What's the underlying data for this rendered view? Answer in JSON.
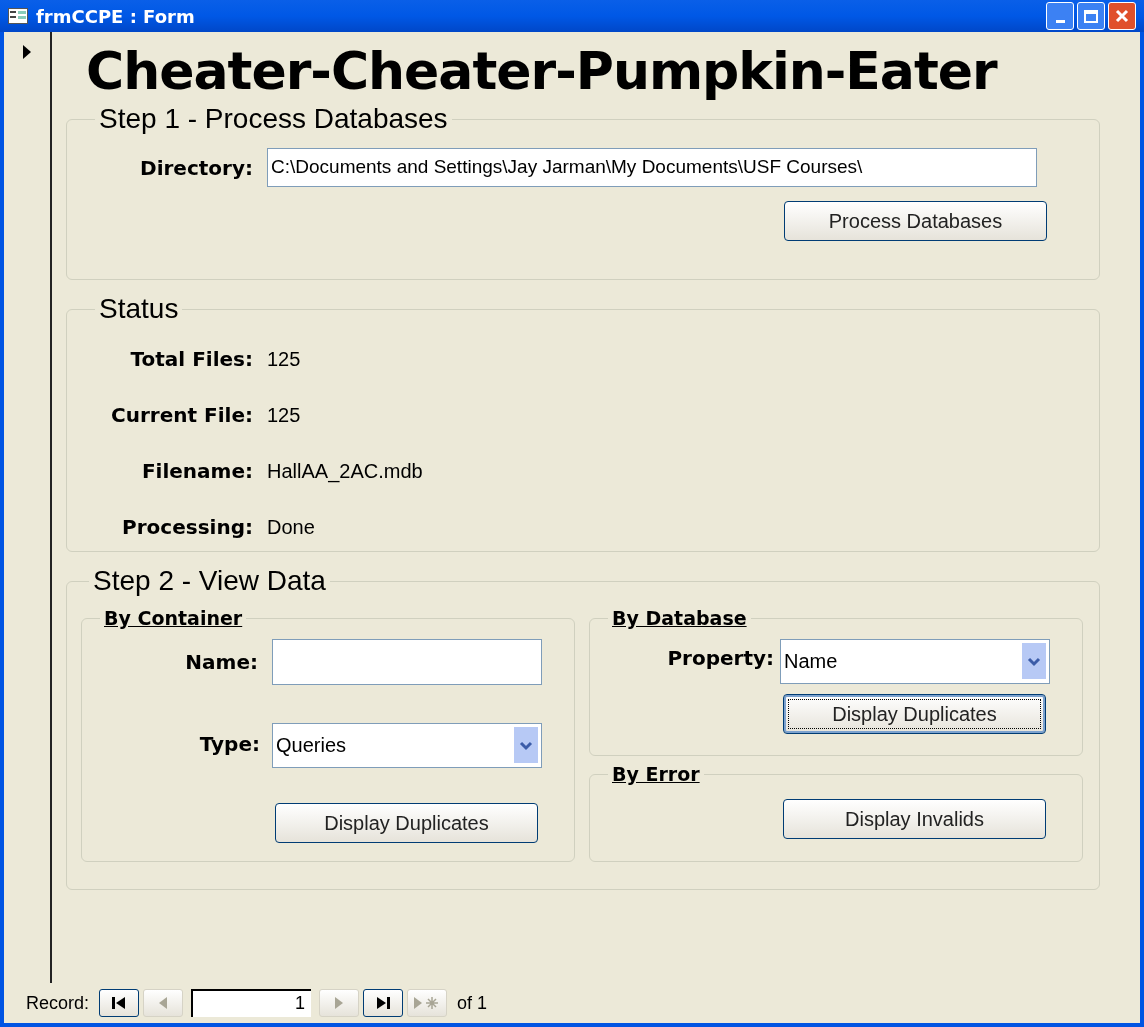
{
  "window": {
    "title": "frmCCPE : Form"
  },
  "heading": "Cheater-Cheater-Pumpkin-Eater",
  "step1": {
    "title": "Step 1 - Process Databases",
    "directory": {
      "label": "Directory:",
      "value": "C:\\Documents and Settings\\Jay Jarman\\My Documents\\USF Courses\\"
    },
    "button": {
      "label": "Process Databases",
      "focused": false
    }
  },
  "status": {
    "title": "Status",
    "rows": [
      {
        "label": "Total Files:",
        "value": "125"
      },
      {
        "label": "Current File:",
        "value": "125"
      },
      {
        "label": "Filename:",
        "value": "HallAA_2AC.mdb"
      },
      {
        "label": "Processing:",
        "value": "Done"
      }
    ]
  },
  "step2": {
    "title": "Step 2 - View Data",
    "by_container": {
      "title": "By Container",
      "name": {
        "label": "Name:"
      },
      "type": {
        "label": "Type:",
        "value": "Queries"
      },
      "button": {
        "label": "Display Duplicates",
        "focused": false
      }
    },
    "by_database": {
      "title": "By Database",
      "property": {
        "label": "Property:",
        "value": "Name"
      },
      "button": {
        "label": "Display Duplicates",
        "focused": true
      }
    },
    "by_error": {
      "title": "By Error",
      "button": {
        "label": "Display Invalids",
        "focused": false
      }
    }
  },
  "record_nav": {
    "label": "Record:",
    "before": [
      {
        "kind": "first",
        "disabled": false
      },
      {
        "kind": "prev",
        "disabled": true
      }
    ],
    "current": "1",
    "after": [
      {
        "kind": "next",
        "disabled": true
      },
      {
        "kind": "last",
        "disabled": false
      },
      {
        "kind": "new",
        "disabled": true
      }
    ],
    "total": "of 1"
  }
}
